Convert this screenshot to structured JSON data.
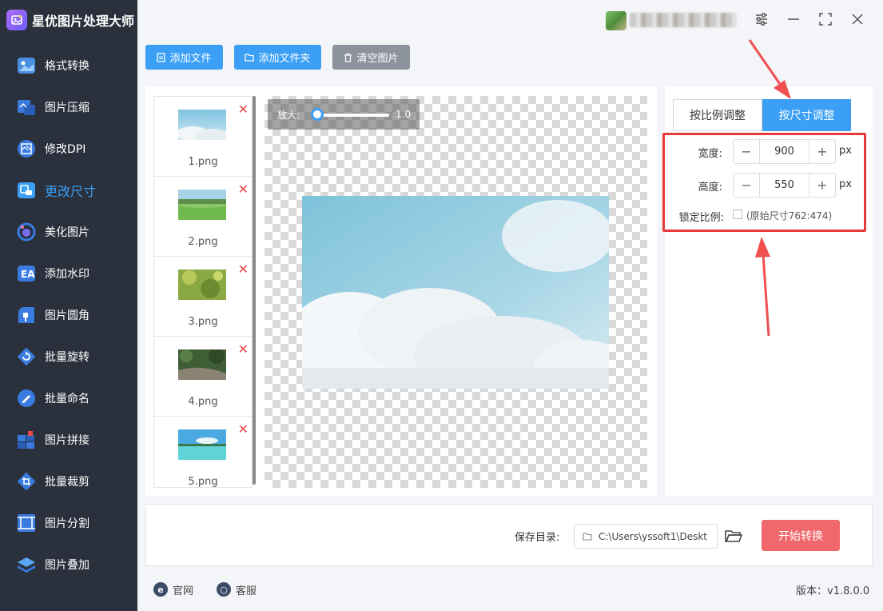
{
  "app": {
    "title": "星优图片处理大师",
    "version_label": "版本：v1.8.0.0"
  },
  "sidebar": {
    "items": [
      {
        "label": "格式转换",
        "icon": "format-convert-icon"
      },
      {
        "label": "图片压缩",
        "icon": "compress-icon"
      },
      {
        "label": "修改DPI",
        "icon": "dpi-icon"
      },
      {
        "label": "更改尺寸",
        "icon": "resize-icon",
        "active": true
      },
      {
        "label": "美化图片",
        "icon": "beautify-icon"
      },
      {
        "label": "添加水印",
        "icon": "watermark-icon"
      },
      {
        "label": "图片圆角",
        "icon": "round-corner-icon"
      },
      {
        "label": "批量旋转",
        "icon": "rotate-icon"
      },
      {
        "label": "批量命名",
        "icon": "rename-icon"
      },
      {
        "label": "图片拼接",
        "icon": "stitch-icon"
      },
      {
        "label": "批量裁剪",
        "icon": "crop-icon"
      },
      {
        "label": "图片分割",
        "icon": "split-icon"
      },
      {
        "label": "图片叠加",
        "icon": "overlay-icon"
      }
    ]
  },
  "toolbar": {
    "add_file": "添加文件",
    "add_folder": "添加文件夹",
    "clear": "清空图片"
  },
  "files": [
    {
      "name": "1.png"
    },
    {
      "name": "2.png"
    },
    {
      "name": "3.png"
    },
    {
      "name": "4.png"
    },
    {
      "name": "5.png"
    }
  ],
  "preview": {
    "zoom_label": "放大:",
    "zoom_value": "1.0",
    "zoom_level": 1.0
  },
  "settings": {
    "tab_ratio": "按比例调整",
    "tab_size": "按尺寸调整",
    "width_label": "宽度:",
    "width_value": "900",
    "height_label": "高度:",
    "height_value": "550",
    "unit": "px",
    "lock_label": "锁定比例:",
    "lock_checked": false,
    "original_size_note": "(原始尺寸762:474)"
  },
  "output": {
    "save_label": "保存目录:",
    "save_path": "C:\\Users\\yssoft1\\Deskt",
    "start_button": "开始转换"
  },
  "footer": {
    "website": "官网",
    "support": "客服"
  },
  "colors": {
    "accent": "#3a9ff5",
    "sidebar_bg": "#2a303c",
    "danger": "#e63b3b",
    "start_button": "#f0686b",
    "clear_button": "#8c939d"
  }
}
